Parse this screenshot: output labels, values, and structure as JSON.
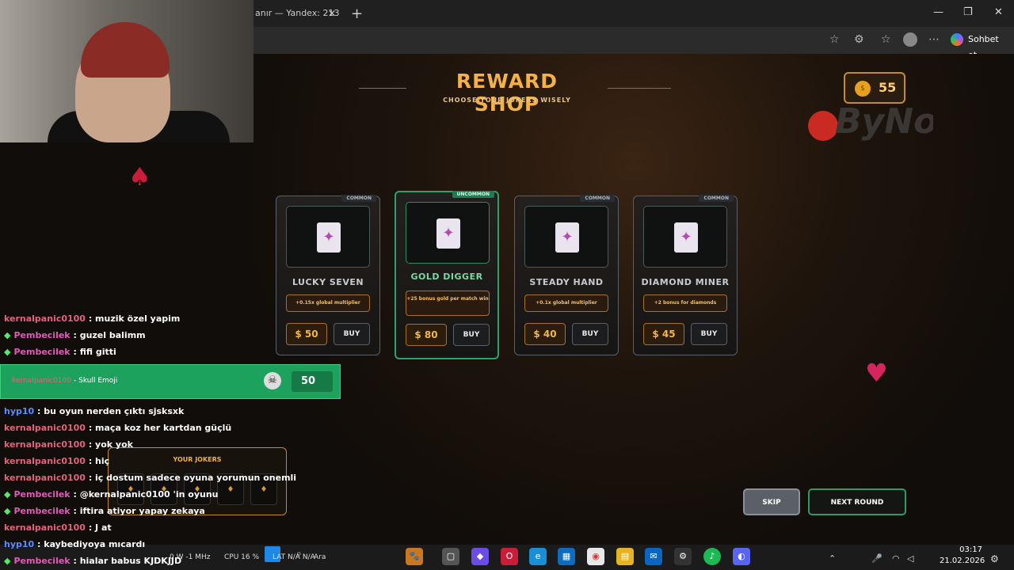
{
  "browser": {
    "tab_title": "anır — Yandex: 213",
    "tab_close": "✕",
    "new_tab": "+",
    "copilot_label": "Sohbet et",
    "window_controls": [
      "—",
      "❐",
      "✕"
    ]
  },
  "game": {
    "title": "REWARD SHOP",
    "subtitle": "CHOOSE YOUR JOKERS WISELY",
    "coins": "55",
    "coin_symbol": "$",
    "logo_text": "ByNo",
    "spade": "♠",
    "heart": "♥",
    "cards": [
      {
        "rarity": "COMMON",
        "name": "LUCKY SEVEN",
        "desc": "+0.15x global multiplier",
        "price": "$ 50",
        "buy": "BUY"
      },
      {
        "rarity": "UNCOMMON",
        "name": "GOLD DIGGER",
        "desc": "+25 bonus gold per match win",
        "price": "$ 80",
        "buy": "BUY"
      },
      {
        "rarity": "COMMON",
        "name": "STEADY HAND",
        "desc": "+0.1x global multiplier",
        "price": "$ 40",
        "buy": "BUY"
      },
      {
        "rarity": "COMMON",
        "name": "DIAMOND MINER",
        "desc": "+2 bonus for diamonds",
        "price": "$ 45",
        "buy": "BUY"
      }
    ],
    "jokers_title": "YOUR JOKERS",
    "skip_label": "SKIP",
    "next_round_label": "NEXT ROUND"
  },
  "chat": {
    "messages_top": [
      {
        "user": "kernalpanic0100",
        "text": ": muzik özel yapim"
      },
      {
        "user": "Pembecilek",
        "text": ": guzel balimm"
      },
      {
        "user": "Pembecilek",
        "text": ": fifi gitti"
      }
    ],
    "redeem": {
      "user": "kernalpanic0100",
      "title": "- Skull Emoji",
      "cost": "50"
    },
    "messages_bottom": [
      {
        "user": "hyp10",
        "text": ": bu oyun nerden çıktı sjsksxk"
      },
      {
        "user": "kernalpanic0100",
        "text": ": maça koz her kartdan güçlü"
      },
      {
        "user": "kernalpanic0100",
        "text": ": yok yok"
      },
      {
        "user": "kernalpanic0100",
        "text": ": hiç"
      },
      {
        "user": "kernalpanic0100",
        "text": ": iç dostum sadece oyuna yorumun onemli"
      },
      {
        "user": "Pembecilek",
        "text": ": @kernalpanic0100 'in oyunu"
      },
      {
        "user": "Pembecilek",
        "text": ": iftira atiyor yapay zekaya"
      },
      {
        "user": "kernalpanic0100",
        "text": ": J at"
      },
      {
        "user": "hyp10",
        "text": ": kaybediyoya mıcardı"
      },
      {
        "user": "Pembecilek",
        "text": ": hialar babus KJDKJJD"
      }
    ]
  },
  "taskbar": {
    "stats": "0 W  -1 MHz",
    "cpu": "CPU 16 %",
    "lat": "LAT N/A  N/A",
    "search": "Ara",
    "time": "03:17",
    "date": "21.02.2026"
  }
}
